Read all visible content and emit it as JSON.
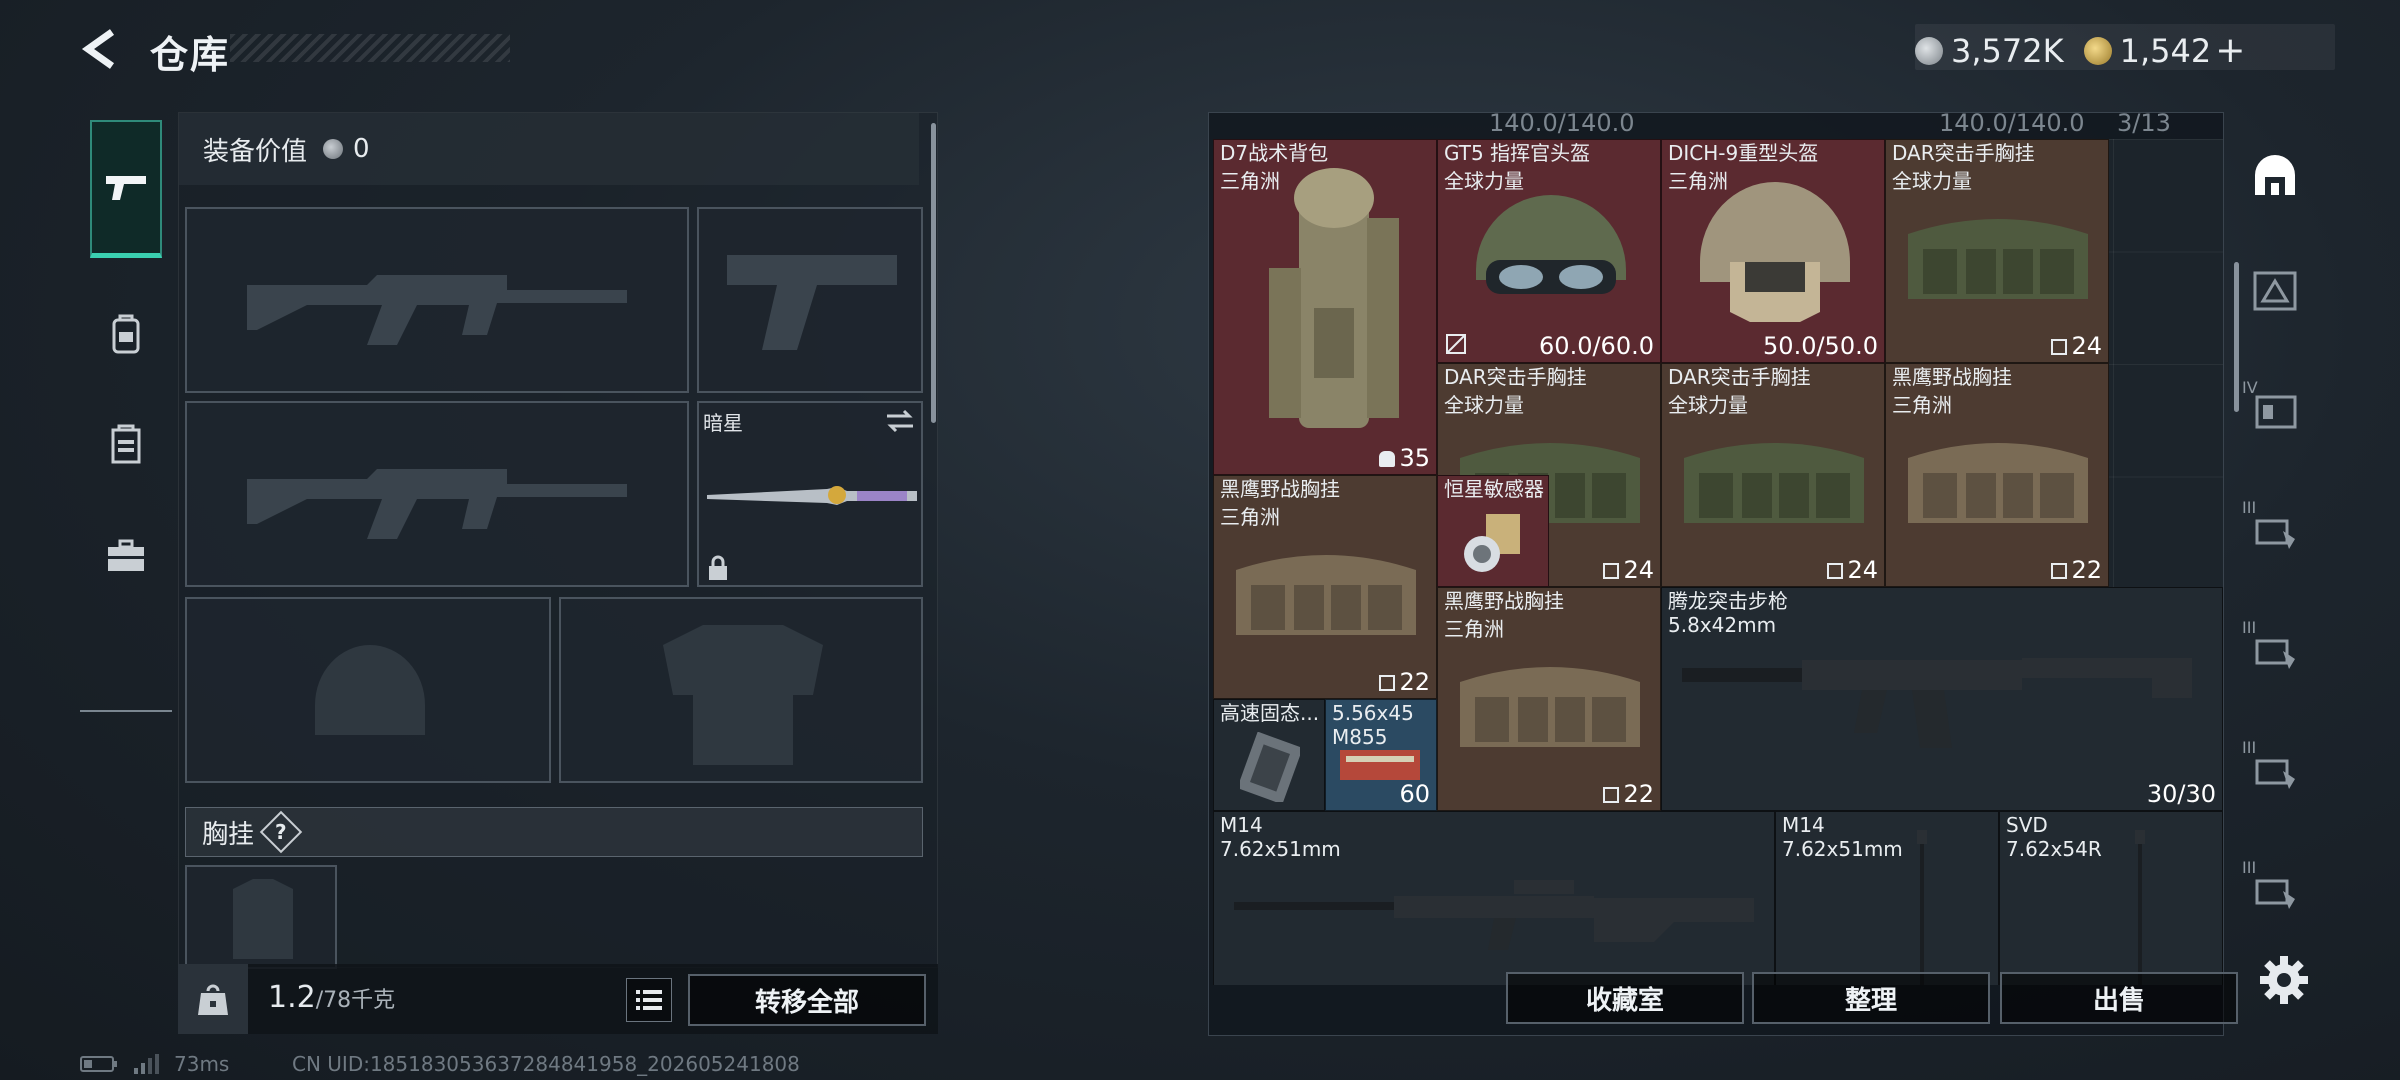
{
  "header": {
    "title": "仓库"
  },
  "currency": {
    "silver": "3,572K",
    "gold": "1,542",
    "add_label": "+"
  },
  "left_nav": [
    {
      "icon": "pistol-icon",
      "active": true
    },
    {
      "icon": "backpack-icon"
    },
    {
      "icon": "chest-rig-icon"
    },
    {
      "icon": "briefcase-icon"
    }
  ],
  "equipment": {
    "value_label": "装备价值",
    "value": "0",
    "melee_name": "暗星",
    "rig_label": "胸挂",
    "rig_help": "?"
  },
  "footer": {
    "weight_current": "1.2",
    "weight_max": "/78千克",
    "transfer_all": "转移全部"
  },
  "status": {
    "ping": "73ms",
    "uid": "CN UID:18518305363728484195­8_202605241808"
  },
  "grid": {
    "header_left": "140.0/140.0",
    "header_mid": "140.0/140.0",
    "header_page": "3/13",
    "items": [
      {
        "name": "D7战术背包",
        "sub": "三角洲",
        "count": "35",
        "icon": "backpack-icon"
      },
      {
        "name": "GT5 指挥官头盔",
        "sub": "全球力量",
        "count": "60.0/60.0",
        "icon": "helmet-icon"
      },
      {
        "name": "DICH-9重型头盔",
        "sub": "三角洲",
        "count": "50.0/50.0",
        "icon": "helmet-icon"
      },
      {
        "name": "DAR突击手胸挂",
        "sub": "全球力量",
        "count": "24",
        "icon": "chest-rig-icon"
      },
      {
        "name": "DAR突击手胸挂",
        "sub": "全球力量",
        "count": "24",
        "icon": "chest-rig-icon"
      },
      {
        "name": "DAR突击手胸挂",
        "sub": "全球力量",
        "count": "24",
        "icon": "chest-rig-icon"
      },
      {
        "name": "黑鹰野战胸挂",
        "sub": "三角洲",
        "count": "22",
        "icon": "chest-rig-icon"
      },
      {
        "name": "黑鹰野战胸挂",
        "sub": "三角洲",
        "count": "22",
        "icon": "chest-rig-icon"
      },
      {
        "name": "恒星敏感器",
        "sub": "",
        "count": "",
        "icon": "sensor-icon"
      },
      {
        "name": "黑鹰野战胸挂",
        "sub": "三角洲",
        "count": "22",
        "icon": "chest-rig-icon"
      },
      {
        "name": "腾龙突击步枪",
        "sub": "5.8x42mm",
        "count": "30/30",
        "icon": "rifle-icon"
      },
      {
        "name": "高速固态...",
        "sub": "",
        "count": "",
        "icon": "ssd-icon"
      },
      {
        "name": "5.56x45",
        "sub": "M855",
        "count": "60",
        "icon": "ammo-box-icon"
      },
      {
        "name": "M14",
        "sub": "7.62x51mm",
        "count": "",
        "icon": "rifle-icon"
      },
      {
        "name": "M14",
        "sub": "7.62x51mm",
        "count": "",
        "icon": "rifle-icon"
      },
      {
        "name": "SVD",
        "sub": "7.62x54R",
        "count": "",
        "icon": "rifle-icon"
      }
    ]
  },
  "right_nav": [
    {
      "icon": "helmet-tab-icon"
    },
    {
      "icon": "tier-tab-icon",
      "label": ""
    },
    {
      "icon": "tier-tab-icon",
      "label": "IV"
    },
    {
      "icon": "tier-tab-icon",
      "label": "III"
    },
    {
      "icon": "tier-tab-icon",
      "label": "III"
    },
    {
      "icon": "tier-tab-icon",
      "label": "III"
    },
    {
      "icon": "tier-tab-icon",
      "label": "III"
    }
  ],
  "buttons": {
    "collection": "收藏室",
    "sort": "整理",
    "sell": "出售"
  },
  "colors": {
    "accent": "#3ad0b0",
    "rarity_red": "#5b2a30",
    "rarity_brown": "#4d3b31",
    "rarity_blue": "#2b4a62"
  }
}
